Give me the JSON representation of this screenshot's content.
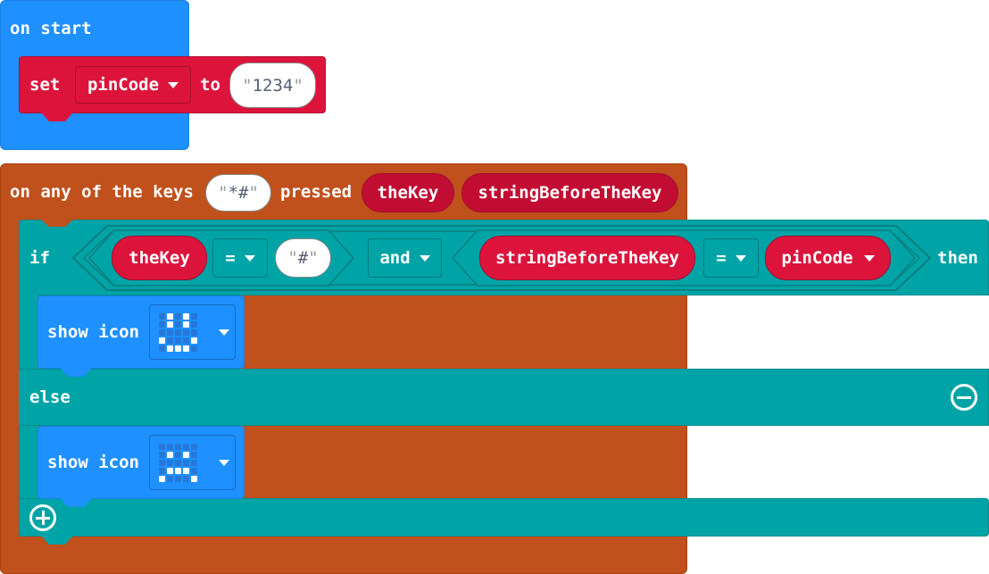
{
  "on_start": {
    "label": "on start",
    "set_block": {
      "set_label": "set",
      "variable": "pinCode",
      "to_label": "to",
      "value": "1234"
    }
  },
  "on_keys": {
    "prefix": "on any of the keys",
    "keys_value": "*#",
    "pressed_label": "pressed",
    "param1": "theKey",
    "param2": "stringBeforeTheKey"
  },
  "if_block": {
    "if_label": "if",
    "left_var": "theKey",
    "op1": "=",
    "left_value": "#",
    "logic_op": "and",
    "right_var": "stringBeforeTheKey",
    "op2": "=",
    "right_value": "pinCode",
    "then_label": "then",
    "else_label": "else"
  },
  "show_icon_1": {
    "label": "show icon",
    "icon": "happy-face-icon",
    "pixels": [
      0,
      1,
      0,
      1,
      0,
      0,
      1,
      0,
      1,
      0,
      0,
      0,
      0,
      0,
      0,
      1,
      0,
      0,
      0,
      1,
      0,
      1,
      1,
      1,
      0
    ]
  },
  "show_icon_2": {
    "label": "show icon",
    "icon": "sad-face-icon",
    "pixels": [
      0,
      0,
      0,
      0,
      0,
      0,
      1,
      0,
      1,
      0,
      0,
      0,
      0,
      0,
      0,
      0,
      1,
      1,
      1,
      0,
      1,
      0,
      0,
      0,
      1
    ]
  },
  "colors": {
    "events": "#1e90ff",
    "variables": "#dc143c",
    "input": "#c0501c",
    "logic": "#00a4a6"
  }
}
